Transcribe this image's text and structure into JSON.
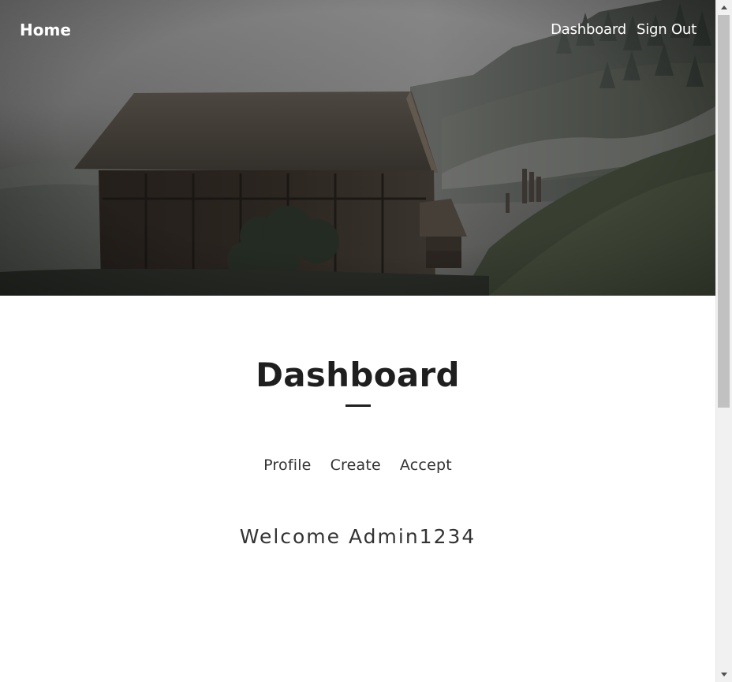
{
  "navbar": {
    "brand": "Home",
    "links": [
      {
        "label": "Dashboard"
      },
      {
        "label": "Sign Out"
      }
    ]
  },
  "hero": {
    "image": "barn-in-foggy-forest-image"
  },
  "main": {
    "title": "Dashboard",
    "sub_nav": [
      {
        "label": "Profile"
      },
      {
        "label": "Create"
      },
      {
        "label": "Accept"
      }
    ],
    "welcome": "Welcome Admin1234"
  },
  "scrollbar": {
    "up_icon": "scroll-up-arrow-icon",
    "down_icon": "scroll-down-arrow-icon",
    "position": 0
  },
  "colors": {
    "nav_text": "#ffffff",
    "title": "#1f1f1f",
    "body_text": "#333333",
    "background": "#ffffff",
    "hero_dark": "#2e302c"
  }
}
